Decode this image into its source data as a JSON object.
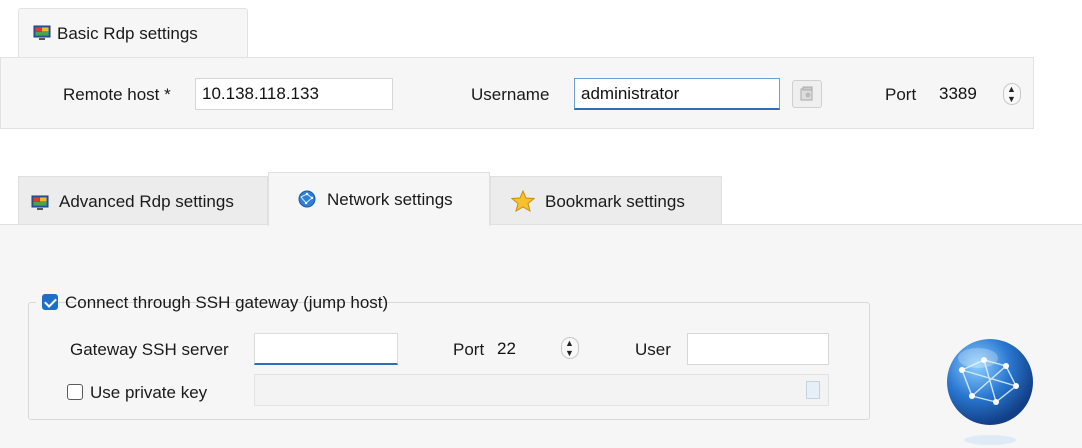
{
  "basic_tab": {
    "label": "Basic Rdp settings",
    "icon": "monitor-icon"
  },
  "basic": {
    "remote_host_label": "Remote host *",
    "remote_host_value": "10.138.118.133",
    "username_label": "Username",
    "username_value": "administrator",
    "port_label": "Port",
    "port_value": "3389"
  },
  "tabs": [
    {
      "label": "Advanced Rdp settings",
      "icon": "monitor-icon",
      "active": false
    },
    {
      "label": "Network settings",
      "icon": "network-globe-icon",
      "active": true
    },
    {
      "label": "Bookmark settings",
      "icon": "star-icon",
      "active": false
    }
  ],
  "network": {
    "ssh_gateway_label": "Connect through SSH gateway (jump host)",
    "ssh_gateway_checked": true,
    "gateway_server_label": "Gateway SSH server",
    "gateway_server_value": "",
    "port_label": "Port",
    "port_value": "22",
    "user_label": "User",
    "user_value": "",
    "private_key_label": "Use private key",
    "private_key_checked": false,
    "private_key_path": ""
  },
  "colors": {
    "accent": "#1f6fc6",
    "panel": "#f6f6f6",
    "border": "#e0e0e0"
  }
}
